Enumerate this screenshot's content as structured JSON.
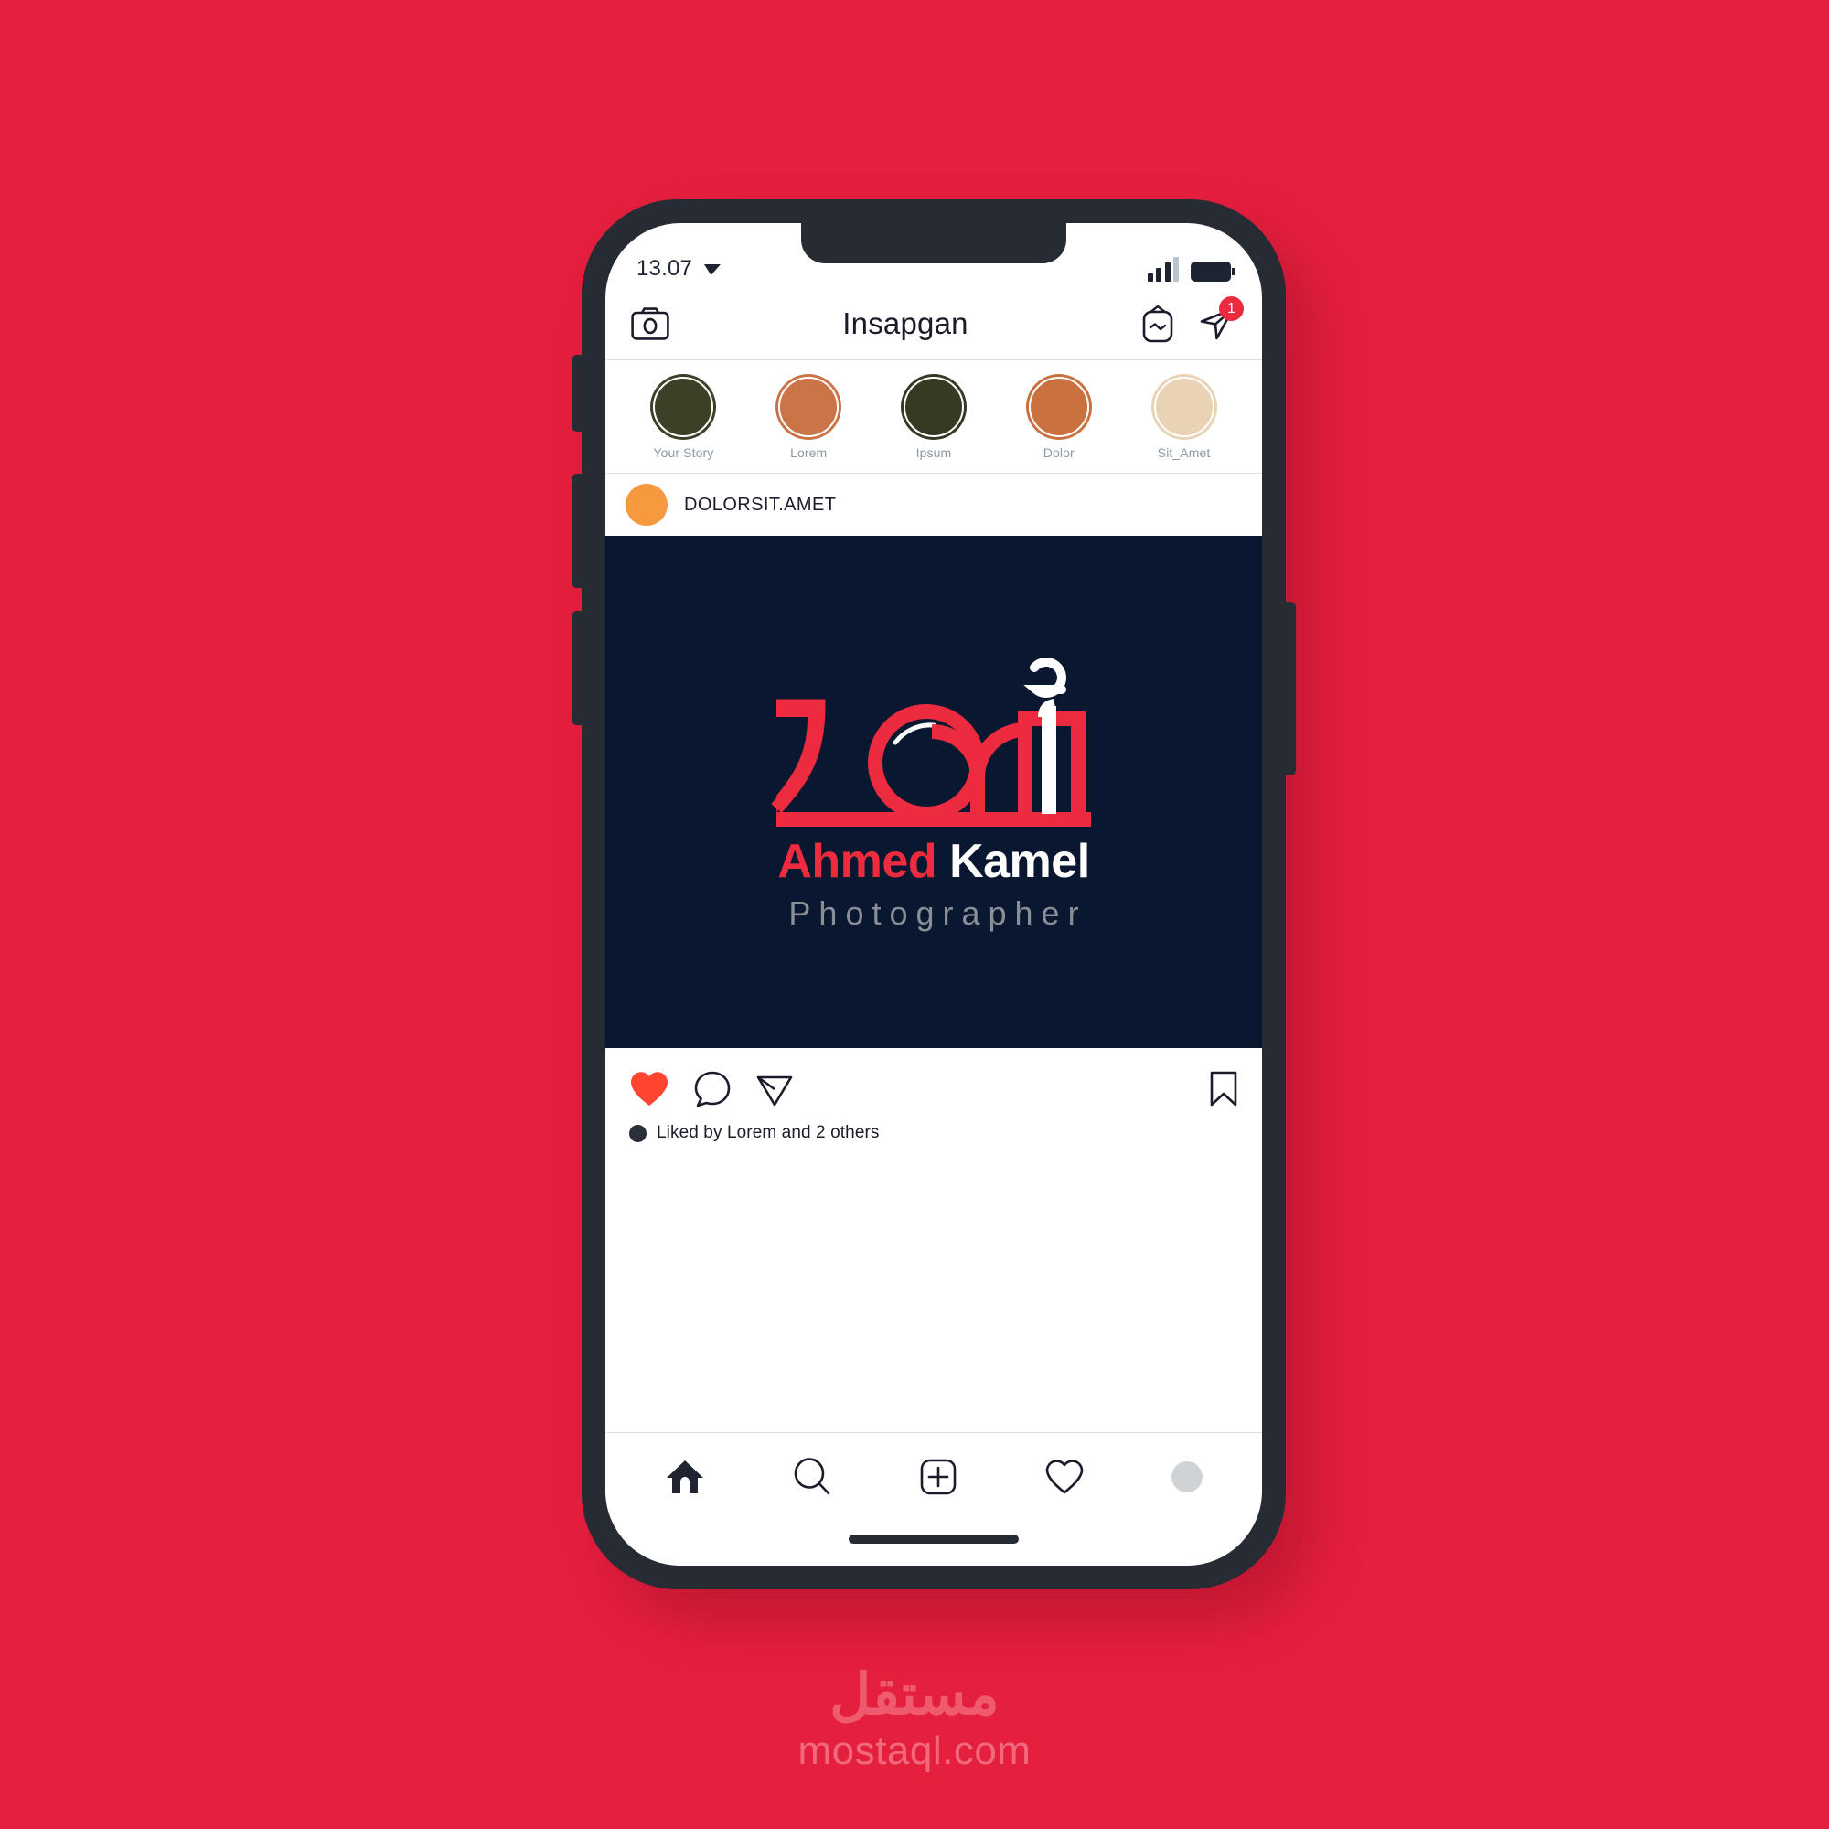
{
  "theme": {
    "background_red": "#e51f3e",
    "phone_frame": "#272b33",
    "accent_red": "#ed2b3f",
    "post_background_navy": "#0a1730",
    "heart_red": "#ff4530"
  },
  "status_bar": {
    "time": "13.07",
    "location_icon": "location-arrow-icon",
    "signal_icon": "signal-bars-icon",
    "signal_bars_filled": 3,
    "signal_bars_total": 4,
    "battery_icon": "battery-full-icon"
  },
  "header": {
    "camera_icon": "camera-icon",
    "title": "Insapgan",
    "igtv_icon": "igtv-icon",
    "direct_icon": "direct-send-icon",
    "direct_badge_count": "1"
  },
  "stories": [
    {
      "label": "Your Story",
      "color": "#3b4026"
    },
    {
      "label": "Lorem",
      "color": "#cb7447"
    },
    {
      "label": "Ipsum",
      "color": "#353a22"
    },
    {
      "label": "Dolor",
      "color": "#c9723f"
    },
    {
      "label": "Sit_Amet",
      "color": "#e8d3b4"
    }
  ],
  "post": {
    "username": "DOLORSIT.AMET",
    "avatar_color": "#f7993f",
    "image": {
      "logo_icon": "arabic-camera-logo-icon",
      "wordmark_first": "Ahmed",
      "wordmark_second": "Kamel",
      "tagline": "Photographer"
    },
    "actions": {
      "like_icon": "heart-filled-icon",
      "comment_icon": "comment-bubble-icon",
      "share_icon": "share-send-icon",
      "save_icon": "bookmark-icon"
    },
    "likes_text": "Liked by Lorem and 2 others"
  },
  "bottom_nav": [
    {
      "name": "home",
      "icon": "home-filled-icon"
    },
    {
      "name": "search",
      "icon": "search-icon"
    },
    {
      "name": "add",
      "icon": "add-post-icon"
    },
    {
      "name": "activity",
      "icon": "heart-outline-icon"
    },
    {
      "name": "profile",
      "icon": "profile-avatar-icon"
    }
  ],
  "watermark": {
    "arabic": "مستقل",
    "latin": "mostaql.com"
  }
}
